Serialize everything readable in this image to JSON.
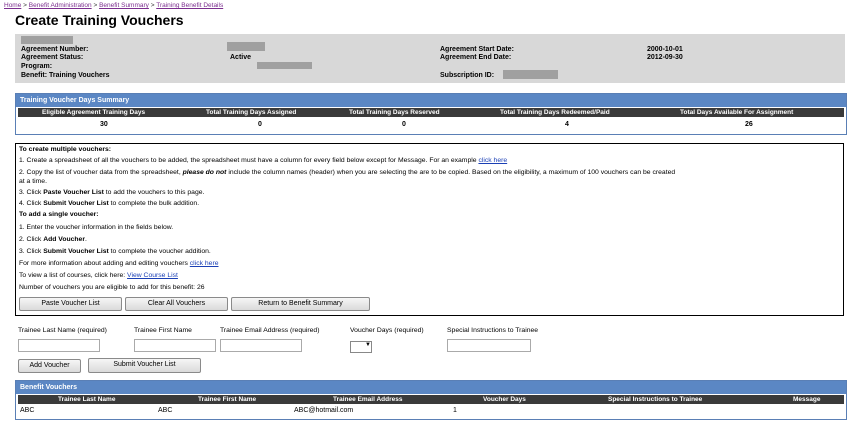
{
  "breadcrumb": {
    "items": [
      "Home",
      "Benefit Administration",
      "Benefit Summary",
      "Training Benefit Details"
    ],
    "separator": ">"
  },
  "page_title": "Create Training Vouchers",
  "agreement": {
    "number_label": "Agreement Number:",
    "status_label": "Agreement Status:",
    "status_value": "Active",
    "program_label": "Program:",
    "benefit_label": "Benefit: Training Vouchers",
    "start_label": "Agreement Start Date:",
    "start_value": "2000-10-01",
    "end_label": "Agreement End Date:",
    "end_value": "2012-09-30",
    "subscription_label": "Subscription ID:"
  },
  "summary": {
    "header": "Training Voucher Days Summary",
    "columns": [
      "Eligible Agreement Training Days",
      "Total Training Days Assigned",
      "Total Training Days Reserved",
      "Total Training Days Redeemed/Paid",
      "Total Days Available For Assignment"
    ],
    "values": [
      "30",
      "0",
      "0",
      "4",
      "26"
    ]
  },
  "instructions": {
    "multi_title": "To create multiple vouchers:",
    "step1": "1. Create a spreadsheet of all the vouchers to be added, the spreadsheet must have a column for every field below except for Message. For an example",
    "step1_link": "click here",
    "step2a": "2. Copy the list of voucher data from the spreadsheet,",
    "step2_em": "please do not",
    "step2b": "include the column names (header) when you are selecting the are to be copied. Based on the eligibility, a maximum of 100 vouchers can be created",
    "step2c": "at a time.",
    "step3a": "3. Click",
    "step3_b": "Paste Voucher List",
    "step3c": "to add the vouchers to this page.",
    "step4a": "4. Click",
    "step4_b": "Submit Voucher List",
    "step4c": "to complete the bulk addition.",
    "single_title": "To add a single voucher:",
    "s1": "1. Enter the voucher information in the fields below.",
    "s2a": "2. Click",
    "s2_b": "Add Voucher",
    "s2c": ".",
    "s3a": "3. Click",
    "s3_b": "Submit Voucher List",
    "s3c": "to complete the voucher addition.",
    "more": "For more information about adding and editing vouchers",
    "more_link": "click here",
    "courses": "To view a list of courses, click here:",
    "courses_link": "View Course List",
    "eligible": "Number of vouchers you are eligible to add for this benefit: 26"
  },
  "buttons": {
    "paste": "Paste Voucher List",
    "clear": "Clear All Vouchers",
    "return": "Return to Benefit Summary",
    "add": "Add Voucher",
    "submit": "Submit Voucher List"
  },
  "form": {
    "last_name": "Trainee Last Name (required)",
    "first_name": "Trainee First Name",
    "email": "Trainee Email Address (required)",
    "days": "Voucher Days (required)",
    "special": "Special Instructions to Trainee"
  },
  "vouchers": {
    "header": "Benefit Vouchers",
    "columns": [
      "Trainee Last Name",
      "Trainee First Name",
      "Trainee Email Address",
      "Voucher Days",
      "Special Instructions to Trainee",
      "Message"
    ],
    "rows": [
      {
        "last": "ABC",
        "first": "ABC",
        "email": "ABC@hotmail.com",
        "days": "1",
        "special": "",
        "message": ""
      }
    ]
  },
  "colors": {
    "accent_blue": "#5b87c4",
    "link": "#1a3fb5",
    "breadcrumb": "#7b2d8e"
  }
}
